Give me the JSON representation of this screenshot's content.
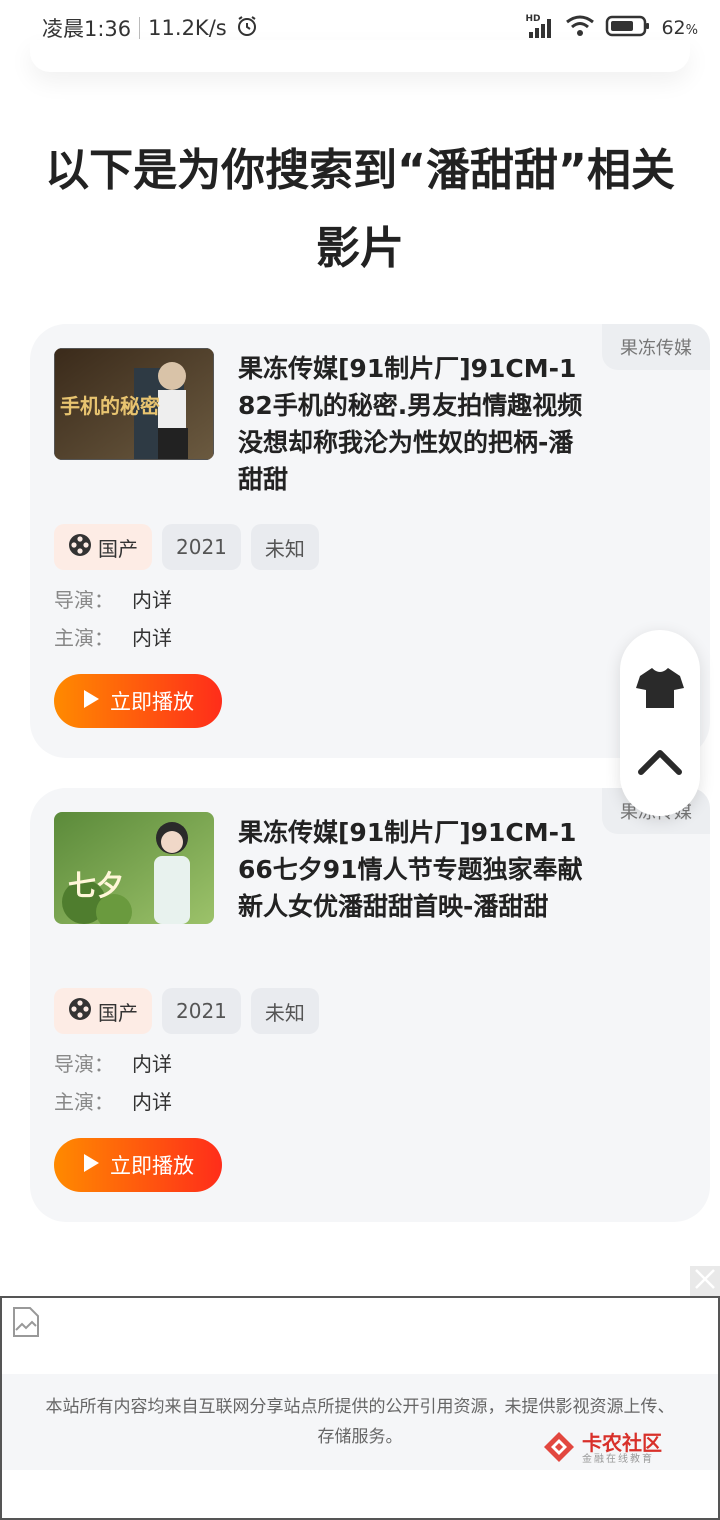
{
  "status_bar": {
    "time": "凌晨1:36",
    "net_speed": "11.2K/s",
    "battery_pct": "62",
    "battery_unit": "%",
    "hd_label": "HD"
  },
  "page": {
    "title": "以下是为你搜索到“潘甜甜”相关影片"
  },
  "results": [
    {
      "source": "果冻传媒",
      "title": "果冻传媒[91制片厂]91CM-182手机的秘密.男友拍情趣视频没想却称我沦为性奴的把柄-潘甜甜",
      "region": "国产",
      "year": "2021",
      "status": "未知",
      "director_label": "导演：",
      "director": "内详",
      "actor_label": "主演：",
      "actor": "内详",
      "play_label": "立即播放",
      "thumb_text": "手机的秘密"
    },
    {
      "source": "果冻传媒",
      "title": "果冻传媒[91制片厂]91CM-166七夕91情人节专题独家奉献新人女优潘甜甜首映-潘甜甜",
      "region": "国产",
      "year": "2021",
      "status": "未知",
      "director_label": "导演：",
      "director": "内详",
      "actor_label": "主演：",
      "actor": "内详",
      "play_label": "立即播放",
      "thumb_text": "七夕"
    }
  ],
  "footer": {
    "text": "本站所有内容均来自互联网分享站点所提供的公开引用资源，未提供影视资源上传、存储服务。"
  },
  "watermark": {
    "title": "卡农社区",
    "subtitle": "金融在线教育"
  },
  "colors": {
    "play_gradient_start": "#ff8a00",
    "play_gradient_end": "#ff2d1a",
    "card_bg": "#f5f6f8",
    "watermark_red": "#d8302a"
  },
  "icons": {
    "region": "film-reel-icon",
    "play": "play-icon",
    "float_top": "tshirt-icon",
    "float_bottom": "chevron-up-icon",
    "ad": "broken-image-icon",
    "ad_close": "close-icon"
  }
}
